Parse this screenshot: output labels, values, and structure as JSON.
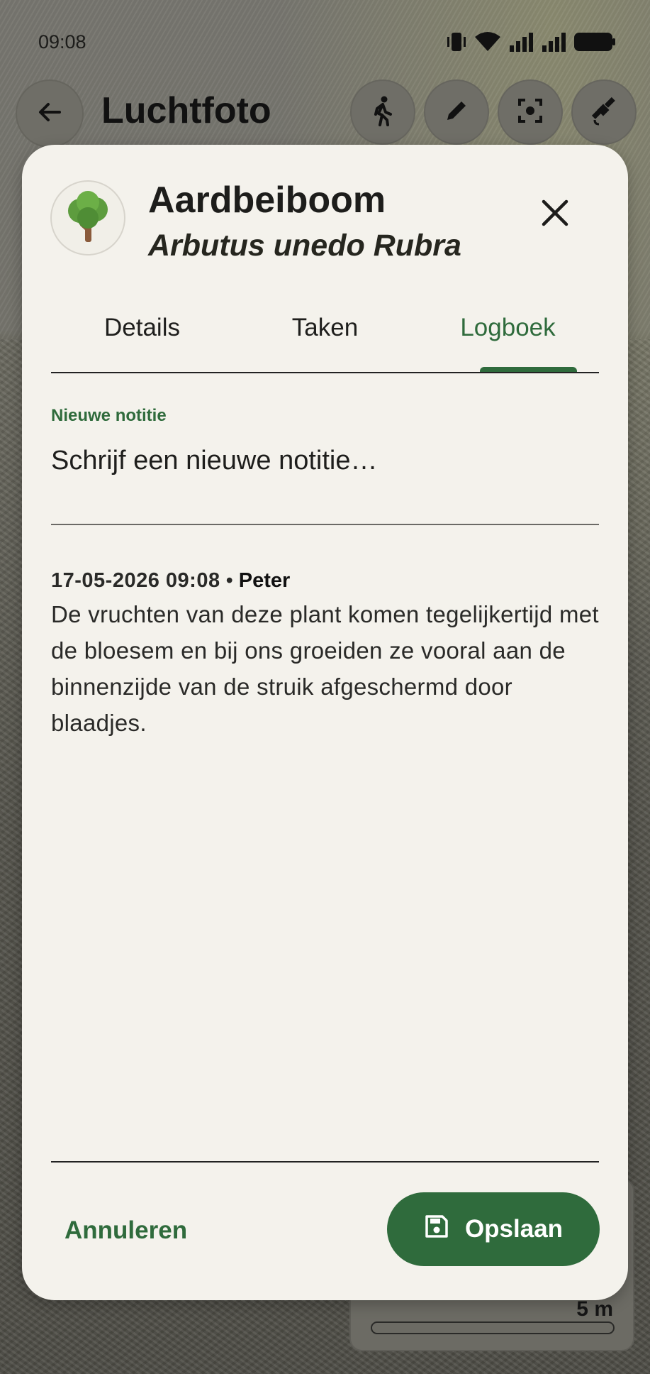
{
  "status_bar": {
    "time": "09:08",
    "icons": [
      "vibrate-icon",
      "wifi-icon",
      "signal-icon",
      "signal-icon",
      "battery-icon"
    ]
  },
  "app_bar": {
    "title": "Luchtfoto",
    "actions": [
      "walk-icon",
      "edit-pencil-icon",
      "center-focus-icon",
      "satellite-icon"
    ]
  },
  "background_card": {
    "label": "5 m"
  },
  "dialog": {
    "plant_name": "Aardbeiboom",
    "plant_latin": "Arbutus unedo Rubra",
    "avatar_icon": "tree-icon",
    "tabs": [
      {
        "label": "Details",
        "active": false
      },
      {
        "label": "Taken",
        "active": false
      },
      {
        "label": "Logboek",
        "active": true
      }
    ],
    "new_note": {
      "label": "Nieuwe notitie",
      "placeholder": "Schrijf een nieuwe notitie…"
    },
    "log_entries": [
      {
        "date": "17-05-2026 09:08",
        "separator": "•",
        "author": "Peter",
        "text": "De vruchten van deze plant komen tegelijkertijd met de bloesem en bij ons groeiden ze vooral aan de binnenzijde van de struik afgeschermd door blaadjes."
      }
    ],
    "cancel_label": "Annuleren",
    "save_label": "Opslaan"
  },
  "colors": {
    "accent": "#2f6b3c",
    "sheet_bg": "#f4f2ec",
    "text": "#1d1d1b"
  }
}
